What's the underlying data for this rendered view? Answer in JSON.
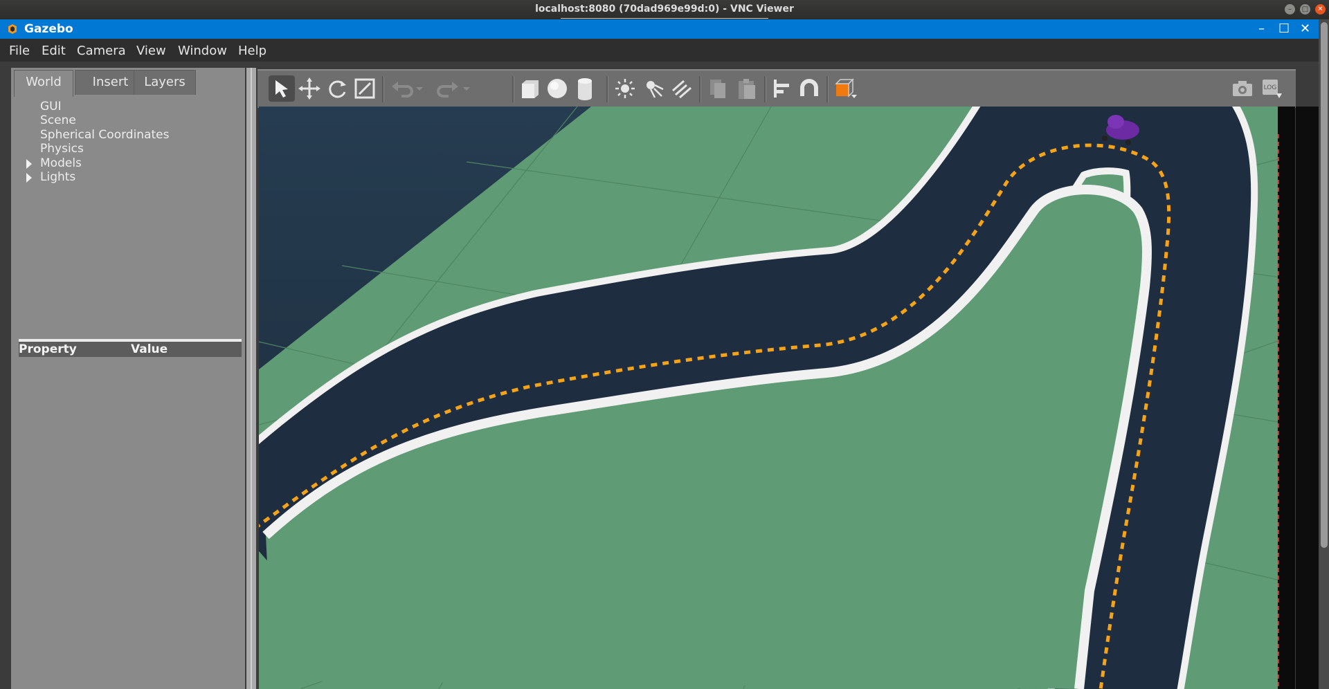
{
  "vnc": {
    "title": "localhost:8080 (70dad969e99d:0) - VNC Viewer",
    "buttons": [
      "minimize",
      "maximize",
      "close"
    ]
  },
  "app": {
    "title": "Gazebo",
    "controls": {
      "minimize": "–",
      "maximize": "☐",
      "close": "✕"
    }
  },
  "menu": [
    "File",
    "Edit",
    "Camera",
    "View",
    "Window",
    "Help"
  ],
  "left_panel": {
    "tabs": [
      "World",
      "Insert",
      "Layers"
    ],
    "active_tab": "World",
    "tree": [
      {
        "label": "GUI",
        "expandable": false
      },
      {
        "label": "Scene",
        "expandable": false
      },
      {
        "label": "Spherical Coordinates",
        "expandable": false
      },
      {
        "label": "Physics",
        "expandable": false
      },
      {
        "label": "Models",
        "expandable": true
      },
      {
        "label": "Lights",
        "expandable": true
      }
    ],
    "property_table": {
      "col_property": "Property",
      "col_value": "Value"
    }
  },
  "toolbar": {
    "icons": [
      "select-arrow-icon",
      "translate-icon",
      "rotate-icon",
      "scale-icon",
      "undo-icon",
      "undo-dropdown-icon",
      "redo-icon",
      "redo-dropdown-icon",
      "box-shape-icon",
      "sphere-shape-icon",
      "cylinder-shape-icon",
      "point-light-icon",
      "spot-light-icon",
      "directional-light-icon",
      "copy-icon",
      "paste-icon",
      "align-icon",
      "snap-magnet-icon",
      "view-angle-icon",
      "screenshot-camera-icon",
      "log-record-icon"
    ]
  },
  "colors": {
    "ground": "#5f9b74",
    "road": "#1e2c40",
    "road_edge": "#f2f2f2",
    "center_line": "#f5a418",
    "robot": "#6c2aa3",
    "accent_title": "#0078d4"
  }
}
